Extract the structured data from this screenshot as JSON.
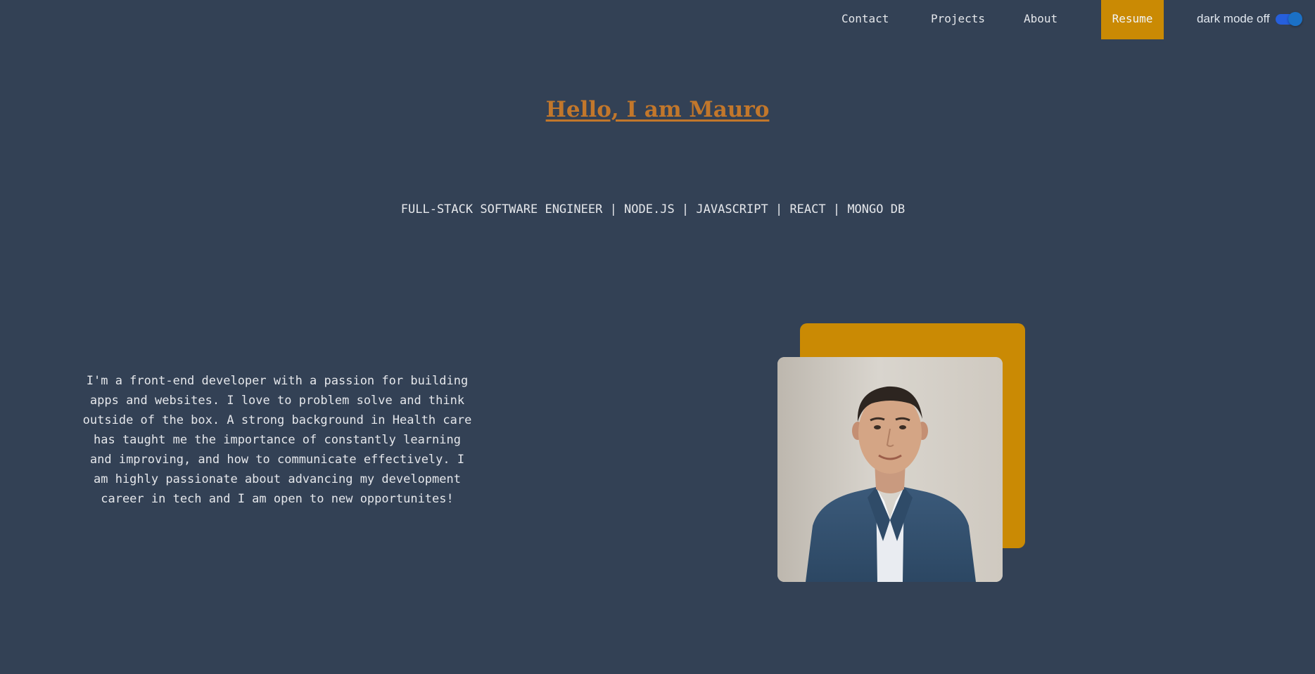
{
  "nav": {
    "links": [
      "Contact",
      "Projects",
      "About"
    ],
    "resume_label": "Resume",
    "dark_mode_label": "dark mode off"
  },
  "hero": {
    "headline": "Hello, I am Mauro",
    "subtitle": "FULL-STACK SOFTWARE ENGINEER | NODE.JS | JAVASCRIPT | REACT | MONGO DB"
  },
  "about": {
    "bio": "I'm a front-end developer with a passion for building apps and websites. I love to problem solve and think outside of the box. A strong background in Health care has taught me the importance of constantly learning and improving, and how to communicate effectively. I am highly passionate about advancing my development career in tech and I am open to new opportunites!"
  },
  "colors": {
    "background": "#334155",
    "accent": "#ca8a04",
    "headline": "#c2772b",
    "toggle": "#1976d2"
  }
}
